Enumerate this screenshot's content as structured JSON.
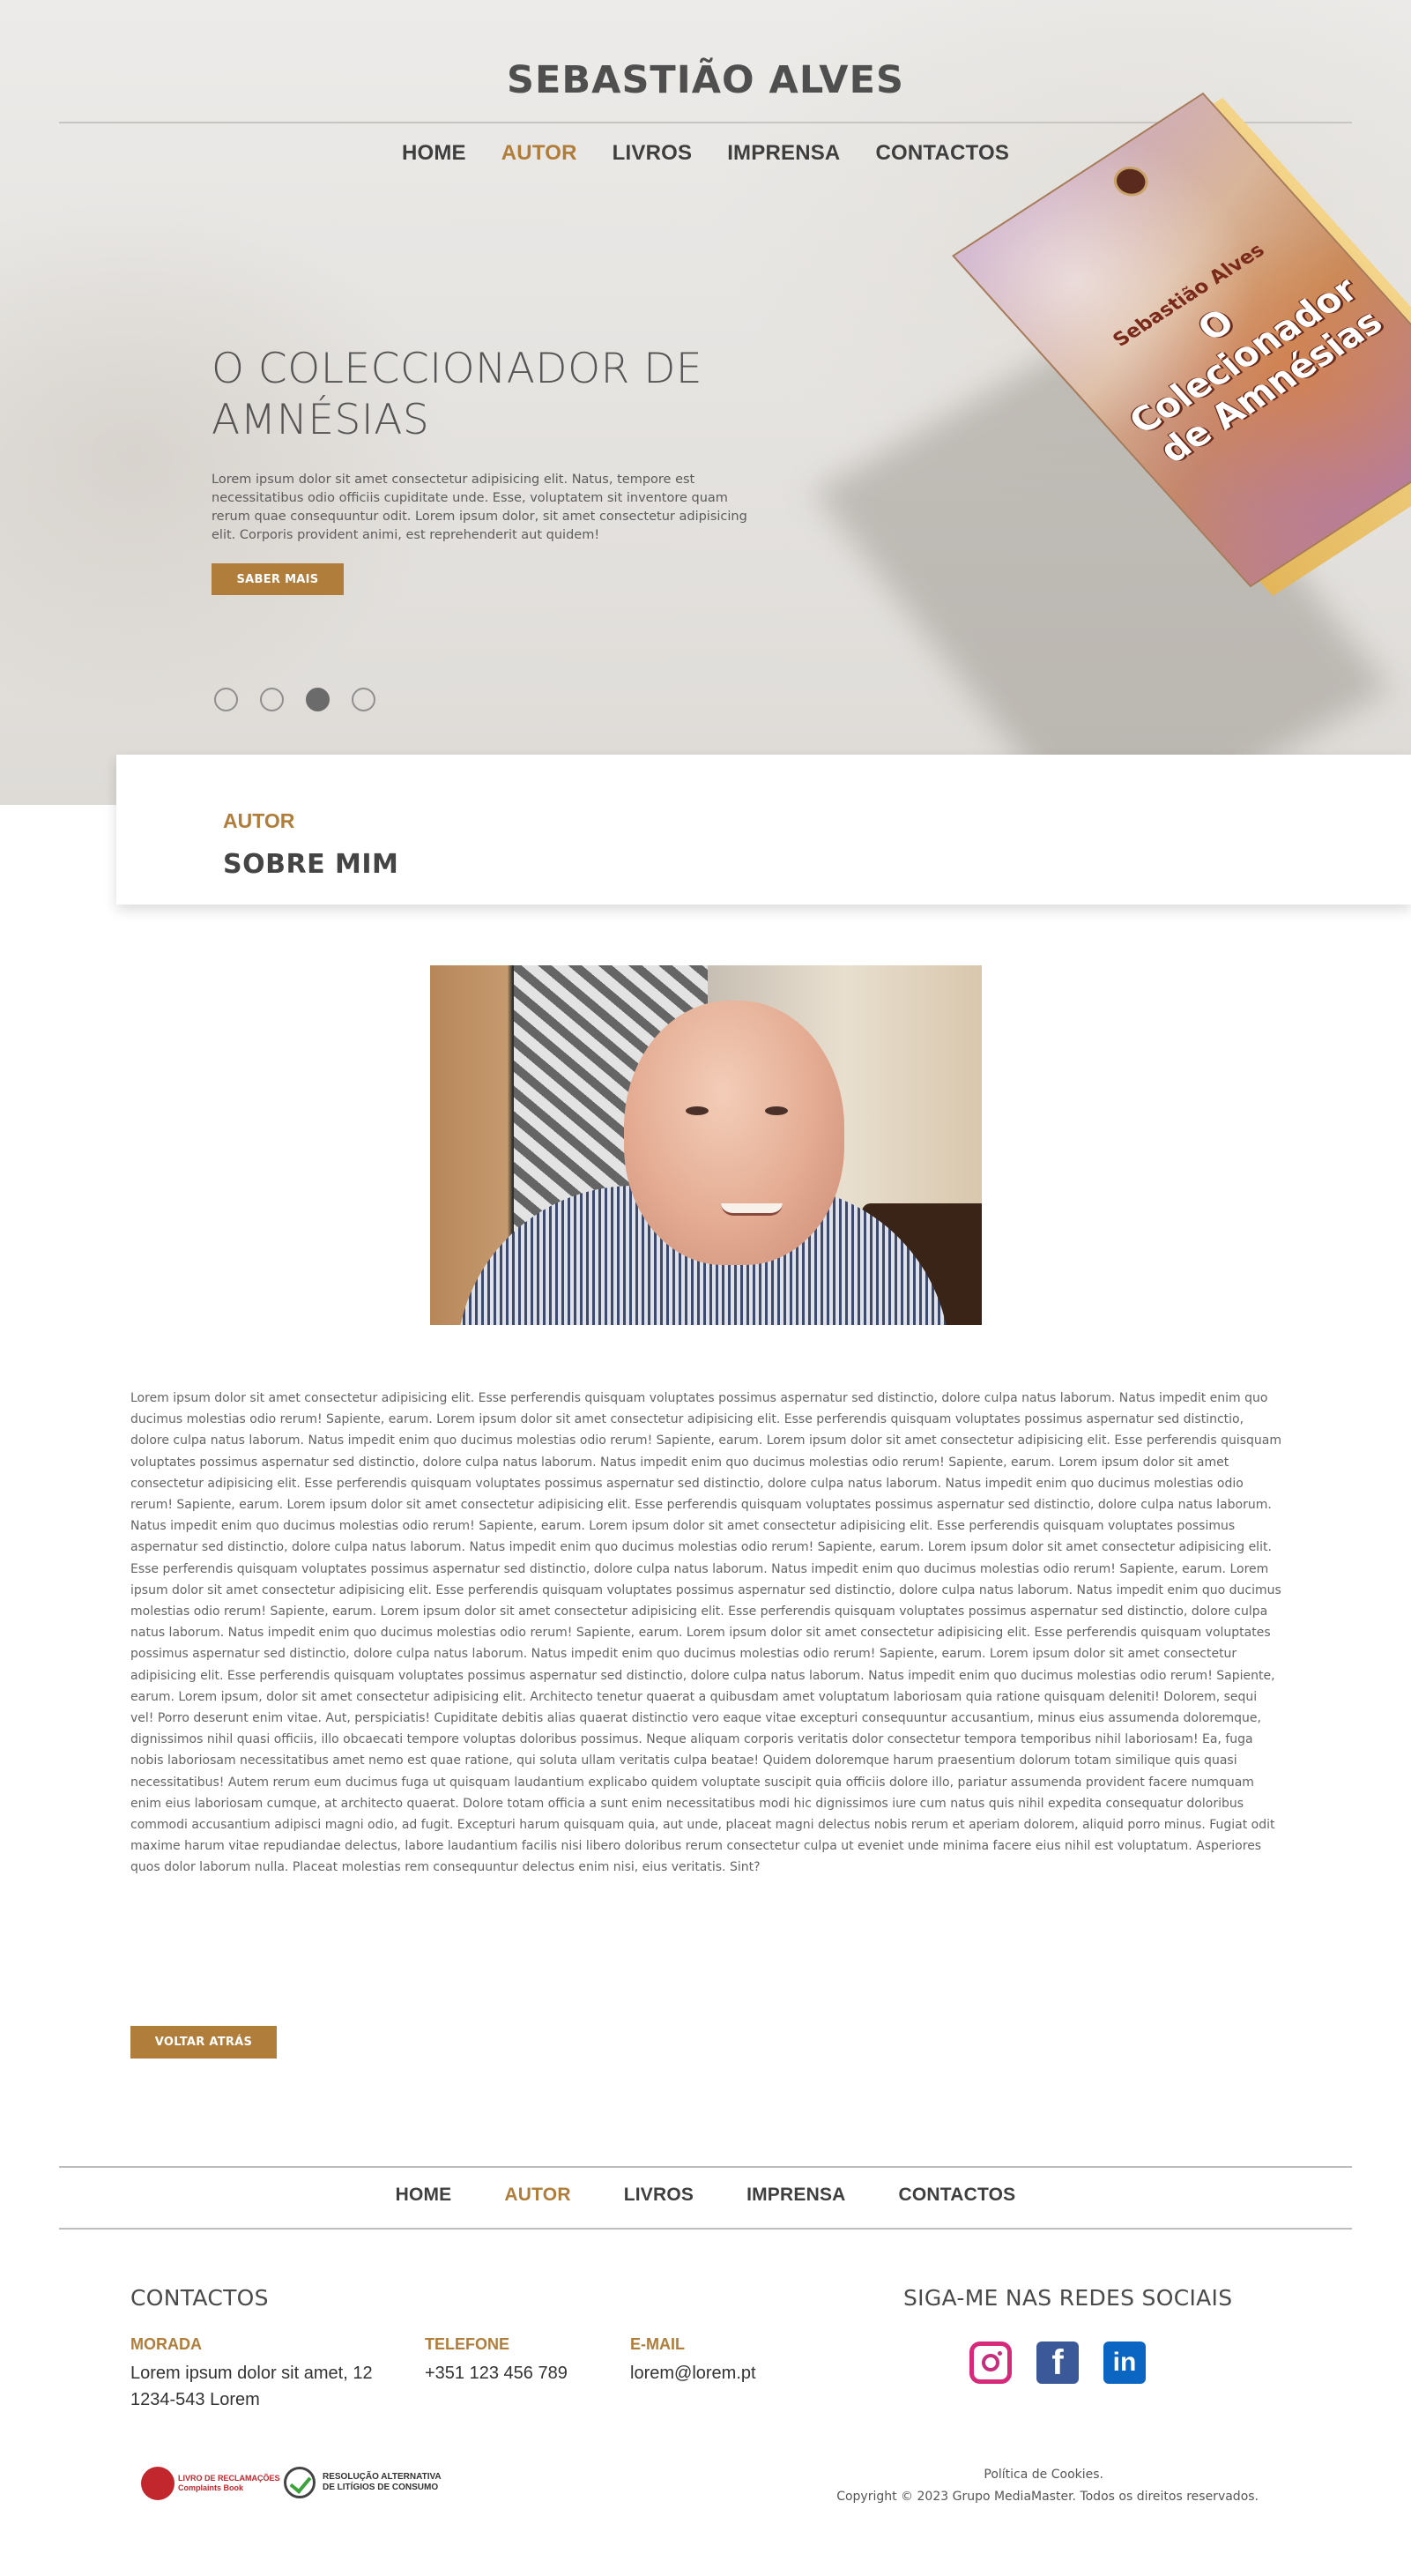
{
  "site": {
    "title": "SEBASTIÃO ALVES"
  },
  "nav": {
    "items": [
      {
        "label": "HOME"
      },
      {
        "label": "AUTOR"
      },
      {
        "label": "LIVROS"
      },
      {
        "label": "IMPRENSA"
      },
      {
        "label": "CONTACTOS"
      }
    ],
    "active": "AUTOR"
  },
  "hero": {
    "title_line1": "O COLECCIONADOR DE",
    "title_line2": "AMNÉSIAS",
    "text": "Lorem ipsum dolor sit amet consectetur adipisicing elit. Natus, tempore est necessitatibus odio officiis cupiditate unde. Esse, voluptatem sit inventore quam rerum quae consequuntur odit. Lorem ipsum dolor, sit amet consectetur adipisicing elit. Corporis provident animi, est reprehenderit aut quidem!",
    "button": "SABER MAIS",
    "slides_total": 4,
    "active_slide": 3,
    "book": {
      "author": "Sebastião Alves",
      "title_line1": "O Colecionador",
      "title_line2": "de Amnésias"
    }
  },
  "section": {
    "kicker": "AUTOR",
    "title": "SOBRE MIM"
  },
  "bio": {
    "text": "Lorem ipsum dolor sit amet consectetur adipisicing elit. Esse perferendis quisquam voluptates possimus aspernatur sed distinctio, dolore culpa natus laborum. Natus impedit enim quo ducimus molestias odio rerum! Sapiente, earum. Lorem ipsum dolor sit amet consectetur adipisicing elit. Esse perferendis quisquam voluptates possimus aspernatur sed distinctio, dolore culpa natus laborum. Natus impedit enim quo ducimus molestias odio rerum! Sapiente, earum. Lorem ipsum dolor sit amet consectetur adipisicing elit. Esse perferendis quisquam voluptates possimus aspernatur sed distinctio, dolore culpa natus laborum. Natus impedit enim quo ducimus molestias odio rerum! Sapiente, earum. Lorem ipsum dolor sit amet consectetur adipisicing elit. Esse perferendis quisquam voluptates possimus aspernatur sed distinctio, dolore culpa natus laborum. Natus impedit enim quo ducimus molestias odio rerum! Sapiente, earum. Lorem ipsum dolor sit amet consectetur adipisicing elit. Esse perferendis quisquam voluptates possimus aspernatur sed distinctio, dolore culpa natus laborum. Natus impedit enim quo ducimus molestias odio rerum! Sapiente, earum. Lorem ipsum dolor sit amet consectetur adipisicing elit. Esse perferendis quisquam voluptates possimus aspernatur sed distinctio, dolore culpa natus laborum. Natus impedit enim quo ducimus molestias odio rerum! Sapiente, earum. Lorem ipsum dolor sit amet consectetur adipisicing elit. Esse perferendis quisquam voluptates possimus aspernatur sed distinctio, dolore culpa natus laborum. Natus impedit enim quo ducimus molestias odio rerum! Sapiente, earum. Lorem ipsum dolor sit amet consectetur adipisicing elit. Esse perferendis quisquam voluptates possimus aspernatur sed distinctio, dolore culpa natus laborum. Natus impedit enim quo ducimus molestias odio rerum! Sapiente, earum. Lorem ipsum dolor sit amet consectetur adipisicing elit. Esse perferendis quisquam voluptates possimus aspernatur sed distinctio, dolore culpa natus laborum. Natus impedit enim quo ducimus molestias odio rerum! Sapiente, earum. Lorem ipsum dolor sit amet consectetur adipisicing elit. Esse perferendis quisquam voluptates possimus aspernatur sed distinctio, dolore culpa natus laborum. Natus impedit enim quo ducimus molestias odio rerum! Sapiente, earum. Lorem ipsum dolor sit amet consectetur adipisicing elit. Esse perferendis quisquam voluptates possimus aspernatur sed distinctio, dolore culpa natus laborum. Natus impedit enim quo ducimus molestias odio rerum! Sapiente, earum. Lorem ipsum, dolor sit amet consectetur adipisicing elit. Architecto tenetur quaerat a quibusdam amet voluptatum laboriosam quia ratione quisquam deleniti! Dolorem, sequi vel! Porro deserunt enim vitae. Aut, perspiciatis! Cupiditate debitis alias quaerat distinctio vero eaque vitae excepturi consequuntur accusantium, minus eius assumenda doloremque, dignissimos nihil quasi officiis, illo obcaecati tempore voluptas doloribus possimus. Neque aliquam corporis veritatis dolor consectetur tempora temporibus nihil laboriosam! Ea, fuga nobis laboriosam necessitatibus amet nemo est quae ratione, qui soluta ullam veritatis culpa beatae! Quidem doloremque harum praesentium dolorum totam similique quis quasi necessitatibus! Autem rerum eum ducimus fuga ut quisquam laudantium explicabo quidem voluptate suscipit quia officiis dolore illo, pariatur assumenda provident facere numquam enim eius laboriosam cumque, at architecto quaerat. Dolore totam officia a sunt enim necessitatibus modi hic dignissimos iure cum natus quis nihil expedita consequatur doloribus commodi accusantium adipisci magni odio, ad fugit. Excepturi harum quisquam quia, aut unde, placeat magni delectus nobis rerum et aperiam dolorem, aliquid porro minus. Fugiat odit maxime harum vitae repudiandae delectus, labore laudantium facilis nisi libero doloribus rerum consectetur culpa ut eveniet unde minima facere eius nihil est voluptatum. Asperiores quos dolor laborum nulla. Placeat molestias rem consequuntur delectus enim nisi, eius veritatis. Sint?",
    "back_button": "VOLTAR ATRÁS"
  },
  "footer": {
    "contacts_heading": "CONTACTOS",
    "morada_label": "MORADA",
    "morada_line1": "Lorem ipsum dolor sit amet, 12",
    "morada_line2": "1234-543 Lorem",
    "telefone_label": "TELEFONE",
    "telefone_value": "+351 123 456 789",
    "email_label": "E-MAIL",
    "email_value": "lorem@lorem.pt",
    "social_heading": "SIGA-ME NAS REDES SOCIAIS",
    "social": [
      {
        "icon": "instagram-icon"
      },
      {
        "icon": "facebook-icon",
        "glyph": "f"
      },
      {
        "icon": "linkedin-icon",
        "glyph": "in"
      }
    ],
    "badges": {
      "livro_reclamacoes_line1": "LIVRO DE RECLAMAÇÕES",
      "livro_reclamacoes_line2": "Complaints Book",
      "ral_line1": "RESOLUÇÃO ALTERNATIVA",
      "ral_line2": "DE LITÍGIOS DE CONSUMO"
    },
    "cookies": "Política de Cookies.",
    "copyright": "Copyright © 2023 Grupo MediaMaster. Todos os direitos reservados."
  },
  "colors": {
    "accent": "#b07d3a",
    "text": "#4a4a4a",
    "background": "#ffffff"
  }
}
